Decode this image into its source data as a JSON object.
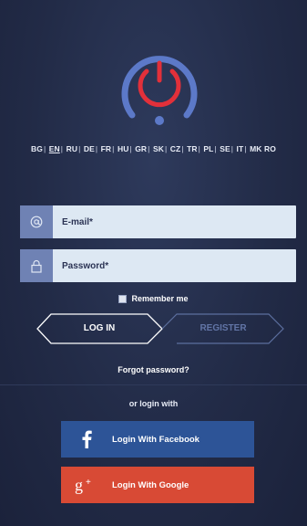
{
  "languages": {
    "items": [
      "BG",
      "EN",
      "RU",
      "DE",
      "FR",
      "HU",
      "GR",
      "SK",
      "CZ",
      "TR",
      "PL",
      "SE",
      "IT",
      "MK",
      "RO"
    ],
    "active": "EN"
  },
  "login_form": {
    "email_placeholder": "E-mail*",
    "password_placeholder": "Password*",
    "remember_label": "Remember me",
    "login_tab_label": "LOG IN",
    "register_tab_label": "REGISTER",
    "forgot_label": "Forgot password?"
  },
  "social": {
    "or_label": "or login with",
    "facebook_label": "Login With Facebook",
    "google_label": "Login With Google"
  },
  "icons": {
    "logo": "power-button-icon",
    "email": "at-sign-icon",
    "password": "lock-icon",
    "facebook": "facebook-icon",
    "google": "google-plus-icon"
  },
  "colors": {
    "background": "#222b47",
    "accent_red": "#e2303a",
    "logo_ring": "#5c79c8",
    "field_bg": "#dde8f3",
    "field_icon_bg": "#6f82b4",
    "facebook": "#2d5497",
    "google": "#d84a35"
  }
}
